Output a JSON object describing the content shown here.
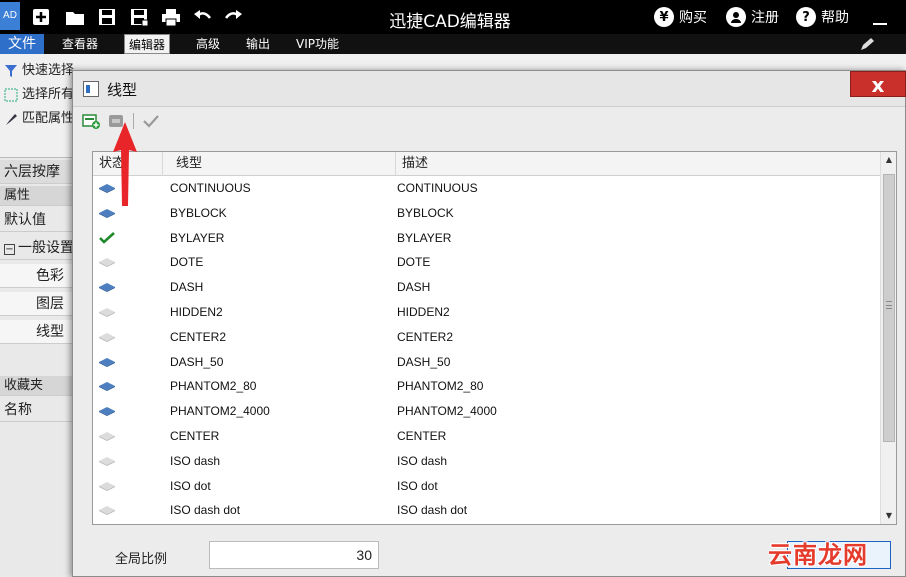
{
  "app": {
    "logo": "AD",
    "title": "迅捷CAD编辑器"
  },
  "titlebar": {
    "buy_label": "购买",
    "buy_symbol": "¥",
    "register_label": "注册",
    "help_label": "帮助",
    "help_symbol": "?"
  },
  "menu": {
    "file": "文件",
    "items": [
      "查看器",
      "编辑器",
      "高级",
      "输出",
      "VIP功能"
    ],
    "active": "编辑器"
  },
  "ribbon": {
    "quick_select": "快速选择",
    "select_all": "选择所有",
    "match_props": "匹配属性"
  },
  "left_panel": {
    "layer_label": "六层按摩",
    "properties": "属性",
    "default_value": "默认值",
    "general": "一般设置",
    "color": "色彩",
    "layer": "图层",
    "linetype": "线型",
    "favorites": "收藏夹",
    "name": "名称"
  },
  "dialog": {
    "title": "线型",
    "close": "x",
    "columns": {
      "status": "状态",
      "linetype": "线型",
      "description": "描述"
    },
    "rows": [
      {
        "status": "on",
        "linetype": "CONTINUOUS",
        "description": "CONTINUOUS"
      },
      {
        "status": "on",
        "linetype": "BYBLOCK",
        "description": "BYBLOCK"
      },
      {
        "status": "current",
        "linetype": "BYLAYER",
        "description": "BYLAYER"
      },
      {
        "status": "off",
        "linetype": "DOTE",
        "description": "DOTE"
      },
      {
        "status": "on",
        "linetype": "DASH",
        "description": "DASH"
      },
      {
        "status": "off",
        "linetype": "HIDDEN2",
        "description": "HIDDEN2"
      },
      {
        "status": "off",
        "linetype": "CENTER2",
        "description": "CENTER2"
      },
      {
        "status": "on",
        "linetype": "DASH_50",
        "description": "DASH_50"
      },
      {
        "status": "on",
        "linetype": "PHANTOM2_80",
        "description": "PHANTOM2_80"
      },
      {
        "status": "on",
        "linetype": "PHANTOM2_4000",
        "description": "PHANTOM2_4000"
      },
      {
        "status": "off",
        "linetype": "CENTER",
        "description": "CENTER"
      },
      {
        "status": "off",
        "linetype": "ISO dash",
        "description": "ISO dash"
      },
      {
        "status": "off",
        "linetype": "ISO dot",
        "description": "ISO dot"
      },
      {
        "status": "off",
        "linetype": "ISO dash dot",
        "description": "ISO dash dot"
      }
    ],
    "global_scale_label": "全局比例",
    "global_scale_value": "30"
  },
  "watermark": "云南龙网",
  "colors": {
    "accent": "#2e6fc9",
    "close": "#c9302c",
    "arrow": "#e8262a"
  }
}
